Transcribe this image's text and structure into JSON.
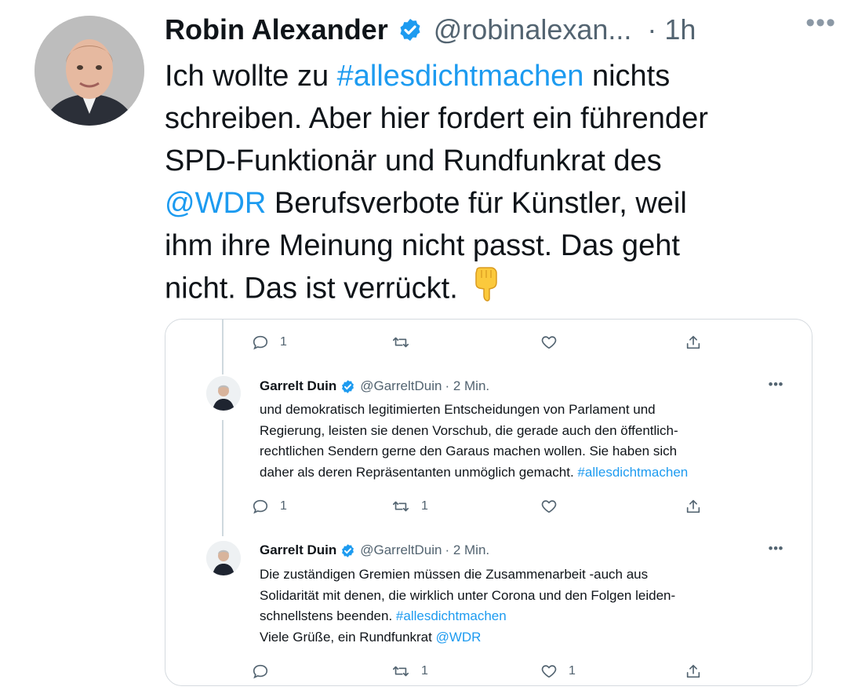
{
  "tweet": {
    "author_name": "Robin Alexander",
    "handle": "@robinalexan...",
    "time": "· 1h",
    "more": "•••",
    "body": {
      "l1_pre": "Ich wollte zu ",
      "l1_tag": "#allesdichtmachen",
      "l1_post": " nichts",
      "l2": "schreiben. Aber hier fordert ein führender",
      "l3": "SPD-Funktionär und Rundfunkrat des",
      "l4_mention": "@WDR",
      "l4_post": "  Berufsverbote für Künstler, weil",
      "l5": "ihm ihre Meinung nicht passt. Das geht",
      "l6": "nicht. Das ist verrückt."
    },
    "emoji_icon": "backhand-index-pointing-down-icon"
  },
  "embed": {
    "top_actions": {
      "reply_count": "1",
      "retweet_count": "",
      "like_count": ""
    },
    "posts": [
      {
        "author_name": "Garrelt Duin",
        "handle": "@GarreltDuin",
        "time": "· 2 Min.",
        "more": "•••",
        "lines": [
          "und demokratisch legitimierten Entscheidungen von Parlament und",
          "Regierung, leisten sie denen Vorschub, die gerade auch den öffentlich-",
          "rechtlichen Sendern gerne den Garaus machen wollen. Sie haben sich"
        ],
        "last_line_pre": "daher als deren Repräsentanten unmöglich gemacht. ",
        "last_line_tag": "#allesdichtmachen",
        "actions": {
          "reply_count": "1",
          "retweet_count": "1",
          "like_count": ""
        }
      },
      {
        "author_name": "Garrelt Duin",
        "handle": "@GarreltDuin",
        "time": "· 2 Min.",
        "more": "•••",
        "lines": [
          "Die zuständigen Gremien müssen die Zusammenarbeit -auch aus",
          "Solidarität mit denen, die wirklich unter Corona und den Folgen leiden-"
        ],
        "line3_pre": "schnellstens beenden. ",
        "line3_tag": "#allesdichtmachen",
        "line4_pre": "Viele Grüße, ein Rundfunkrat ",
        "line4_mention": "@WDR",
        "actions": {
          "reply_count": "",
          "retweet_count": "1",
          "like_count": "1"
        }
      }
    ]
  },
  "colors": {
    "link": "#1d9bf0",
    "secondary_text": "#536471",
    "verified_badge": "#1d9bf0",
    "border": "#d5dadf"
  }
}
